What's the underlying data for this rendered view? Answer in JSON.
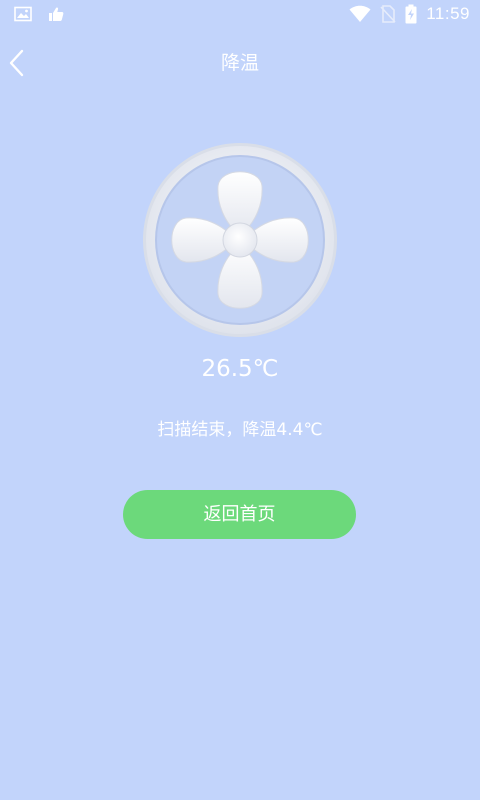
{
  "status_bar": {
    "time": "11:59",
    "icons": [
      "image-icon",
      "thumbs-up-icon",
      "wifi-icon",
      "no-sim-icon",
      "battery-charging-icon"
    ]
  },
  "header": {
    "back_icon": "chevron-left-icon",
    "title": "降温"
  },
  "main": {
    "fan_icon": "fan-icon",
    "temperature": "26.5℃",
    "result": "扫描结束，降温4.4℃",
    "home_button_label": "返回首页"
  },
  "colors": {
    "background": "#c2d4fb",
    "button": "#6cd97b",
    "text": "#ffffff"
  }
}
